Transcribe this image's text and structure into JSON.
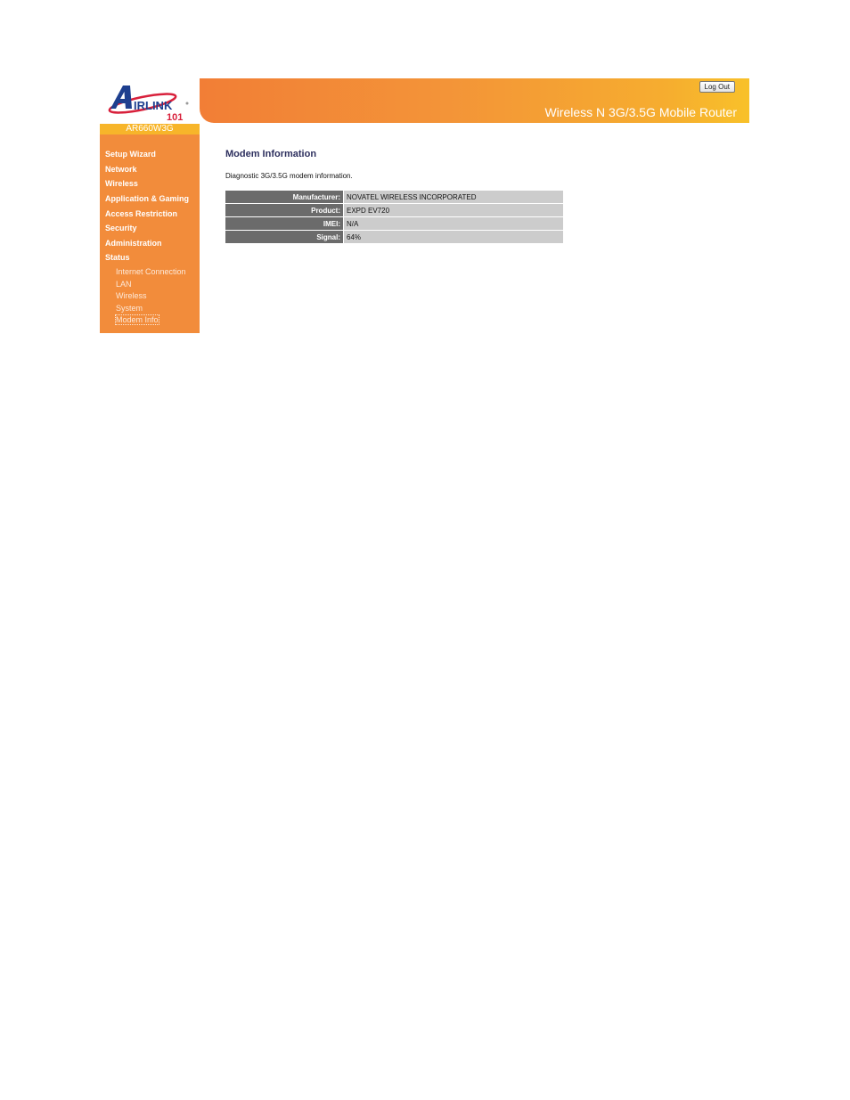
{
  "brand": {
    "logo_text": "AIRLINK",
    "logo_sub": "101",
    "model": "AR660W3G",
    "product_title": "Wireless N 3G/3.5G Mobile Router"
  },
  "header": {
    "logout_label": "Log Out"
  },
  "sidebar": {
    "items": [
      {
        "label": "Setup Wizard"
      },
      {
        "label": "Network"
      },
      {
        "label": "Wireless"
      },
      {
        "label": "Application & Gaming"
      },
      {
        "label": "Access Restriction"
      },
      {
        "label": "Security"
      },
      {
        "label": "Administration"
      },
      {
        "label": "Status"
      }
    ],
    "status_subitems": [
      {
        "label": "Internet Connection"
      },
      {
        "label": "LAN"
      },
      {
        "label": "Wireless"
      },
      {
        "label": "System"
      },
      {
        "label": "Modem Info",
        "active": true
      }
    ]
  },
  "main": {
    "title": "Modem Information",
    "description": "Diagnostic 3G/3.5G modem information.",
    "rows": [
      {
        "label": "Manufacturer:",
        "value": "NOVATEL WIRELESS INCORPORATED"
      },
      {
        "label": "Product:",
        "value": "EXPD EV720"
      },
      {
        "label": "IMEI:",
        "value": "N/A"
      },
      {
        "label": "Signal:",
        "value": "64%"
      }
    ]
  },
  "colors": {
    "sidebar_bg": "#f28c3b",
    "model_bar": "#f7b52a",
    "title_color": "#2d2f5e",
    "label_cell": "#6b6b6b",
    "value_cell": "#cccccc"
  }
}
